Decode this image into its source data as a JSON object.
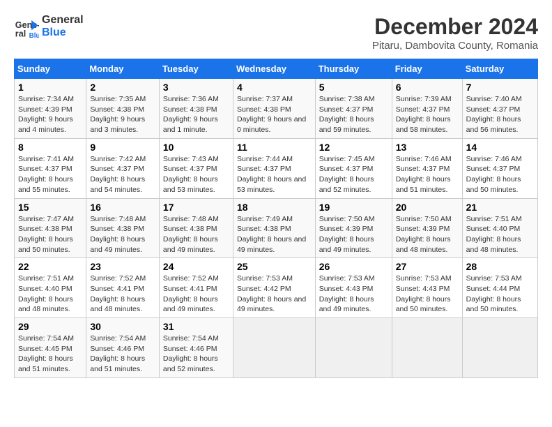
{
  "header": {
    "logo_line1": "General",
    "logo_line2": "Blue",
    "title": "December 2024",
    "subtitle": "Pitaru, Dambovita County, Romania"
  },
  "days_of_week": [
    "Sunday",
    "Monday",
    "Tuesday",
    "Wednesday",
    "Thursday",
    "Friday",
    "Saturday"
  ],
  "weeks": [
    [
      {
        "day": "1",
        "sunrise": "7:34 AM",
        "sunset": "4:39 PM",
        "daylight": "9 hours and 4 minutes."
      },
      {
        "day": "2",
        "sunrise": "7:35 AM",
        "sunset": "4:38 PM",
        "daylight": "9 hours and 3 minutes."
      },
      {
        "day": "3",
        "sunrise": "7:36 AM",
        "sunset": "4:38 PM",
        "daylight": "9 hours and 1 minute."
      },
      {
        "day": "4",
        "sunrise": "7:37 AM",
        "sunset": "4:38 PM",
        "daylight": "9 hours and 0 minutes."
      },
      {
        "day": "5",
        "sunrise": "7:38 AM",
        "sunset": "4:37 PM",
        "daylight": "8 hours and 59 minutes."
      },
      {
        "day": "6",
        "sunrise": "7:39 AM",
        "sunset": "4:37 PM",
        "daylight": "8 hours and 58 minutes."
      },
      {
        "day": "7",
        "sunrise": "7:40 AM",
        "sunset": "4:37 PM",
        "daylight": "8 hours and 56 minutes."
      }
    ],
    [
      {
        "day": "8",
        "sunrise": "7:41 AM",
        "sunset": "4:37 PM",
        "daylight": "8 hours and 55 minutes."
      },
      {
        "day": "9",
        "sunrise": "7:42 AM",
        "sunset": "4:37 PM",
        "daylight": "8 hours and 54 minutes."
      },
      {
        "day": "10",
        "sunrise": "7:43 AM",
        "sunset": "4:37 PM",
        "daylight": "8 hours and 53 minutes."
      },
      {
        "day": "11",
        "sunrise": "7:44 AM",
        "sunset": "4:37 PM",
        "daylight": "8 hours and 53 minutes."
      },
      {
        "day": "12",
        "sunrise": "7:45 AM",
        "sunset": "4:37 PM",
        "daylight": "8 hours and 52 minutes."
      },
      {
        "day": "13",
        "sunrise": "7:46 AM",
        "sunset": "4:37 PM",
        "daylight": "8 hours and 51 minutes."
      },
      {
        "day": "14",
        "sunrise": "7:46 AM",
        "sunset": "4:37 PM",
        "daylight": "8 hours and 50 minutes."
      }
    ],
    [
      {
        "day": "15",
        "sunrise": "7:47 AM",
        "sunset": "4:38 PM",
        "daylight": "8 hours and 50 minutes."
      },
      {
        "day": "16",
        "sunrise": "7:48 AM",
        "sunset": "4:38 PM",
        "daylight": "8 hours and 49 minutes."
      },
      {
        "day": "17",
        "sunrise": "7:48 AM",
        "sunset": "4:38 PM",
        "daylight": "8 hours and 49 minutes."
      },
      {
        "day": "18",
        "sunrise": "7:49 AM",
        "sunset": "4:38 PM",
        "daylight": "8 hours and 49 minutes."
      },
      {
        "day": "19",
        "sunrise": "7:50 AM",
        "sunset": "4:39 PM",
        "daylight": "8 hours and 49 minutes."
      },
      {
        "day": "20",
        "sunrise": "7:50 AM",
        "sunset": "4:39 PM",
        "daylight": "8 hours and 48 minutes."
      },
      {
        "day": "21",
        "sunrise": "7:51 AM",
        "sunset": "4:40 PM",
        "daylight": "8 hours and 48 minutes."
      }
    ],
    [
      {
        "day": "22",
        "sunrise": "7:51 AM",
        "sunset": "4:40 PM",
        "daylight": "8 hours and 48 minutes."
      },
      {
        "day": "23",
        "sunrise": "7:52 AM",
        "sunset": "4:41 PM",
        "daylight": "8 hours and 48 minutes."
      },
      {
        "day": "24",
        "sunrise": "7:52 AM",
        "sunset": "4:41 PM",
        "daylight": "8 hours and 49 minutes."
      },
      {
        "day": "25",
        "sunrise": "7:53 AM",
        "sunset": "4:42 PM",
        "daylight": "8 hours and 49 minutes."
      },
      {
        "day": "26",
        "sunrise": "7:53 AM",
        "sunset": "4:43 PM",
        "daylight": "8 hours and 49 minutes."
      },
      {
        "day": "27",
        "sunrise": "7:53 AM",
        "sunset": "4:43 PM",
        "daylight": "8 hours and 50 minutes."
      },
      {
        "day": "28",
        "sunrise": "7:53 AM",
        "sunset": "4:44 PM",
        "daylight": "8 hours and 50 minutes."
      }
    ],
    [
      {
        "day": "29",
        "sunrise": "7:54 AM",
        "sunset": "4:45 PM",
        "daylight": "8 hours and 51 minutes."
      },
      {
        "day": "30",
        "sunrise": "7:54 AM",
        "sunset": "4:46 PM",
        "daylight": "8 hours and 51 minutes."
      },
      {
        "day": "31",
        "sunrise": "7:54 AM",
        "sunset": "4:46 PM",
        "daylight": "8 hours and 52 minutes."
      },
      null,
      null,
      null,
      null
    ]
  ]
}
